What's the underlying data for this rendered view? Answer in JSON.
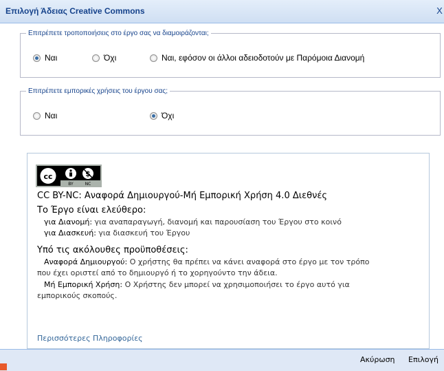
{
  "dialog": {
    "title": "Επιλογή Άδειας Creative Commons",
    "close_symbol": "X"
  },
  "modifications": {
    "legend": "Επιτρέπετε τροποποιήσεις στο έργο σας να διαμοιράζονται;",
    "options": [
      "Ναι",
      "Όχι",
      "Ναι, εφόσον οι άλλοι αδειοδοτούν με Παρόμοια Διανομή"
    ],
    "selected": "Ναι"
  },
  "commercial": {
    "legend": "Επιτρέπετε εμπορικές χρήσεις του έργου σας;",
    "options": [
      "Ναι",
      "Όχι"
    ],
    "selected": "Όχι"
  },
  "license": {
    "badge": {
      "cc": "cc",
      "by": "BY",
      "nc": "NC"
    },
    "name": "CC BY-NC: Αναφορά Δημιουργού-Μή Εμπορική Χρήση 4.0 Διεθνές",
    "free_heading": "Το Έργο είναι ελεύθερο:",
    "share_label": "για Διανομή:",
    "share_text": "για αναπαραγωγή, διανομή και παρουσίαση του Έργου στο κοινό",
    "remix_label": "για Διασκευή:",
    "remix_text": "για διασκευή του Έργου",
    "conditions_heading": "Υπό τις ακόλουθες προϋποθέσεις:",
    "attribution_label": "Αναφορά Δημιουργού:",
    "attribution_text_1": "Ο χρήστης θα πρέπει να κάνει αναφορά στο έργο με τον τρόπο",
    "attribution_text_2": "που έχει οριστεί από το δημιουργό ή το χορηγούντο την άδεια.",
    "noncommercial_label": "Μή Εμπορική Χρήση:",
    "noncommercial_text_1": "Ο Χρήστης δεν μπορεί να χρησιμοποιήσει το έργο αυτό για",
    "noncommercial_text_2": "εμπορικούς σκοπούς.",
    "more_info": "Περισσότερες Πληροφορίες"
  },
  "footer": {
    "cancel": "Ακύρωση",
    "select": "Επιλογή"
  },
  "colors": {
    "title_text": "#15428b",
    "link": "#336699",
    "radio_selected": "#3a6ea5"
  },
  "icons": [
    "close-icon",
    "creative-commons-icon",
    "attribution-icon",
    "noncommercial-icon"
  ]
}
